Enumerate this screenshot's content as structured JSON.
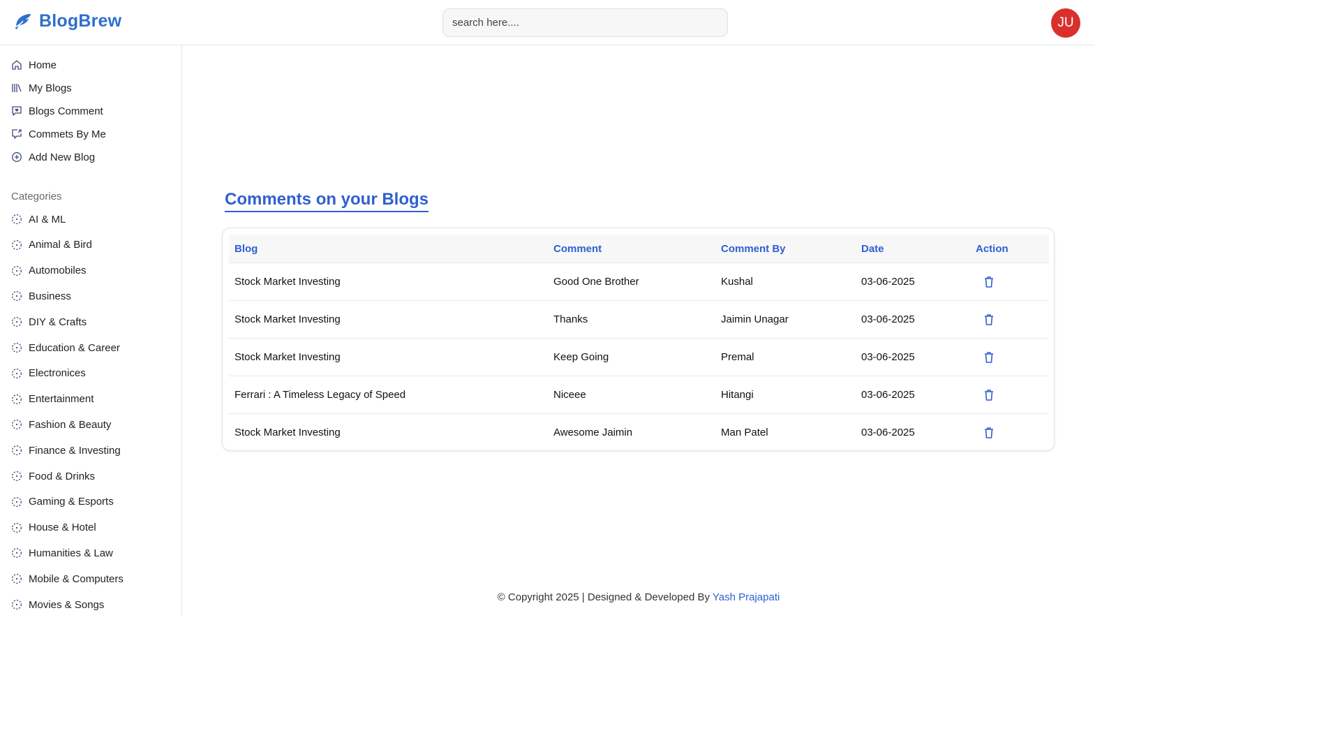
{
  "header": {
    "brand_name": "BlogBrew",
    "brand_icon": "feather-icon",
    "search_placeholder": "search here....",
    "avatar_initials": "JU",
    "avatar_color": "#d9302c",
    "brand_color": "#2f6fcb"
  },
  "sidebar": {
    "nav": [
      {
        "label": "Home",
        "icon": "home-icon"
      },
      {
        "label": "My Blogs",
        "icon": "books-icon"
      },
      {
        "label": "Blogs Comment",
        "icon": "comment-heart-icon"
      },
      {
        "label": "Commets By Me",
        "icon": "comment-share-icon"
      },
      {
        "label": "Add New Blog",
        "icon": "plus-circle-icon"
      }
    ],
    "categories_title": "Categories",
    "categories": [
      "AI & ML",
      "Animal & Bird",
      "Automobiles",
      "Business",
      "DIY & Crafts",
      "Education & Career",
      "Electronices",
      "Entertainment",
      "Fashion & Beauty",
      "Finance & Investing",
      "Food & Drinks",
      "Gaming & Esports",
      "House & Hotel",
      "Humanities & Law",
      "Mobile & Computers",
      "Movies & Songs"
    ]
  },
  "main": {
    "title": "Comments on your Blogs",
    "columns": [
      "Blog",
      "Comment",
      "Comment By",
      "Date",
      "Action"
    ],
    "rows": [
      {
        "blog": "Stock Market Investing",
        "comment": "Good One Brother",
        "by": "Kushal",
        "date": "03-06-2025"
      },
      {
        "blog": "Stock Market Investing",
        "comment": "Thanks",
        "by": "Jaimin Unagar",
        "date": "03-06-2025"
      },
      {
        "blog": "Stock Market Investing",
        "comment": "Keep Going",
        "by": "Premal",
        "date": "03-06-2025"
      },
      {
        "blog": "Ferrari : A Timeless Legacy of Speed",
        "comment": "Niceee",
        "by": "Hitangi",
        "date": "03-06-2025"
      },
      {
        "blog": "Stock Market Investing",
        "comment": "Awesome Jaimin",
        "by": "Man Patel",
        "date": "03-06-2025"
      }
    ],
    "accent_color": "#2f5fd0"
  },
  "footer": {
    "text": "© Copyright 2025 | Designed & Developed By",
    "author": "Yash Prajapati"
  }
}
